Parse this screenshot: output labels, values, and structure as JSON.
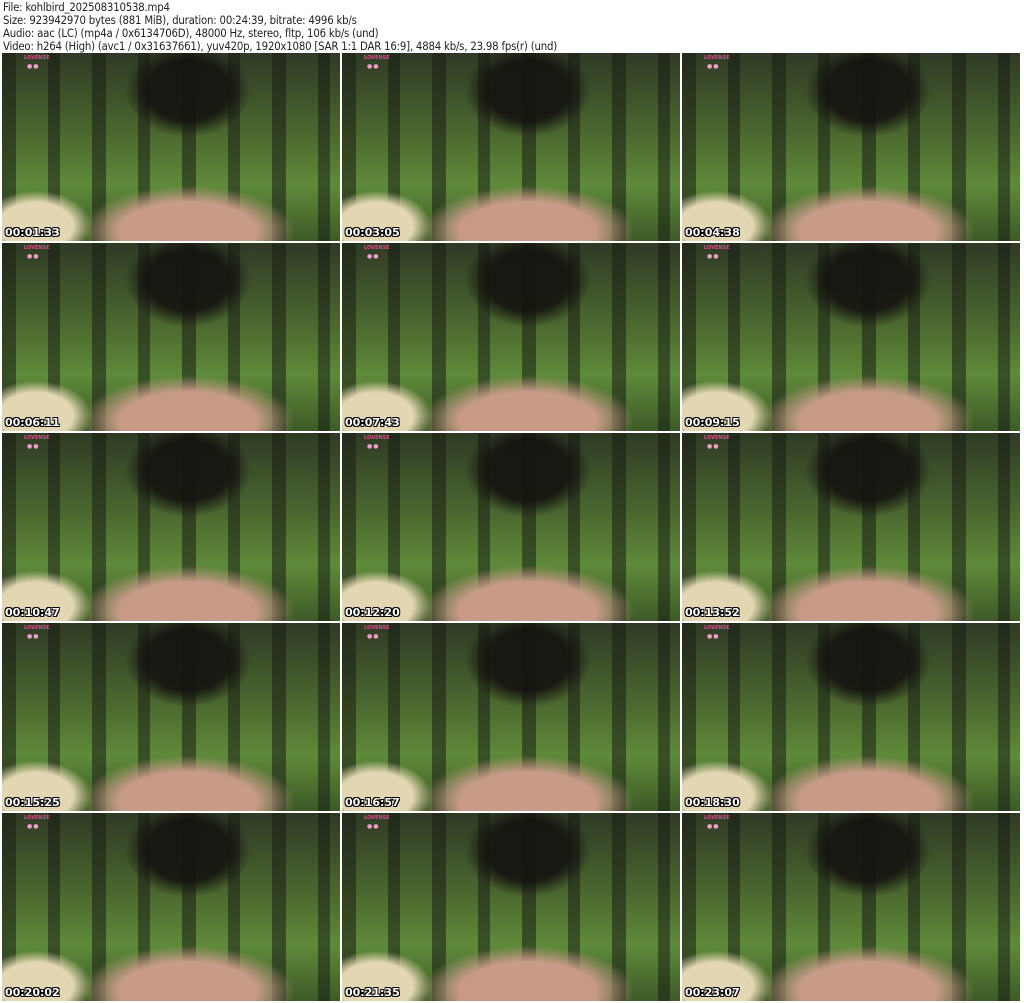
{
  "info": {
    "file": "File: kohlbird_202508310538.mp4",
    "size": "Size: 923942970 bytes (881 MiB), duration: 00:24:39, bitrate: 4996 kb/s",
    "audio": "Audio: aac (LC) (mp4a / 0x6134706D), 48000 Hz, stereo, fltp, 106 kb/s (und)",
    "video": "Video: h264 (High) (avc1 / 0x31637661), yuv420p, 1920x1080 [SAR 1:1 DAR 16:9], 4884 kb/s, 23.98 fps(r) (und)"
  },
  "watermark": "LOVENSE",
  "thumbnails": [
    {
      "timestamp": "00:01:33"
    },
    {
      "timestamp": "00:03:05"
    },
    {
      "timestamp": "00:04:38"
    },
    {
      "timestamp": "00:06:11"
    },
    {
      "timestamp": "00:07:43"
    },
    {
      "timestamp": "00:09:15"
    },
    {
      "timestamp": "00:10:47"
    },
    {
      "timestamp": "00:12:20"
    },
    {
      "timestamp": "00:13:52"
    },
    {
      "timestamp": "00:15:25"
    },
    {
      "timestamp": "00:16:57"
    },
    {
      "timestamp": "00:18:30"
    },
    {
      "timestamp": "00:20:02"
    },
    {
      "timestamp": "00:21:35"
    },
    {
      "timestamp": "00:23:07"
    }
  ]
}
